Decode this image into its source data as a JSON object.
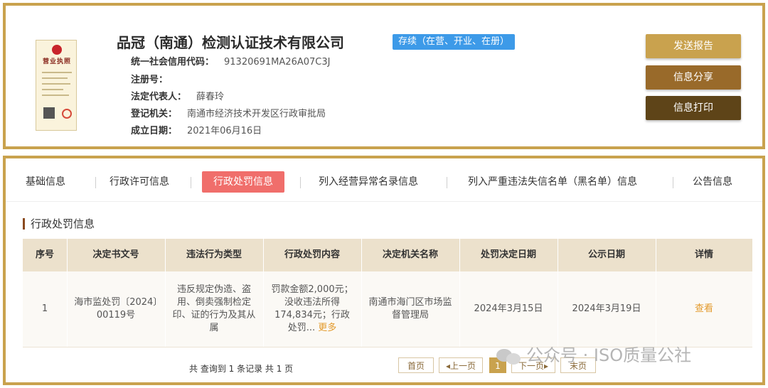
{
  "company": {
    "name": "品冠（南通）检测认证技术有限公司",
    "status": "存续（在营、开业、在册）",
    "license_title": "营业执照",
    "fields": [
      {
        "label": "统一社会信用代码：",
        "value": "91320691MA26A07C3J"
      },
      {
        "label": "注册号：",
        "value": ""
      },
      {
        "label": "法定代表人：",
        "value": "薛春玲"
      },
      {
        "label": "登记机关：",
        "value": "南通市经济技术开发区行政审批局"
      },
      {
        "label": "成立日期：",
        "value": "2021年06月16日"
      }
    ]
  },
  "actions": {
    "send": "发送报告",
    "share": "信息分享",
    "print": "信息打印"
  },
  "tabs": [
    {
      "label": "基础信息"
    },
    {
      "label": "行政许可信息"
    },
    {
      "label": "行政处罚信息",
      "active": true
    },
    {
      "label": "列入经营异常名录信息"
    },
    {
      "label": "列入严重违法失信名单（黑名单）信息"
    },
    {
      "label": "公告信息"
    }
  ],
  "section_title": "行政处罚信息",
  "table": {
    "headers": [
      "序号",
      "决定书文号",
      "违法行为类型",
      "行政处罚内容",
      "决定机关名称",
      "处罚决定日期",
      "公示日期",
      "详情"
    ],
    "rows": [
      {
        "index": "1",
        "doc_no": "海市监处罚〔2024〕00119号",
        "violation": "违反规定伪造、盗用、倒卖强制检定印、证的行为及其从属",
        "content": "罚款金额2,000元；没收违法所得174,834元；行政处罚...",
        "more": "更多",
        "authority": "南通市海门区市场监督管理局",
        "decision_date": "2024年3月15日",
        "publish_date": "2024年3月19日",
        "detail": "查看"
      }
    ]
  },
  "pagination": {
    "summary": "共 查询到 1 条记录 共 1 页",
    "first": "首页",
    "prev": "上一页",
    "current": "1",
    "next": "下一页",
    "last": "末页"
  },
  "watermark": "公众号 · ISO质量公社",
  "colors": {
    "gold_border": "#c9a24e",
    "active_tab": "#f06e6b",
    "link": "#e39a2c",
    "status_badge": "#3d9ae8"
  }
}
